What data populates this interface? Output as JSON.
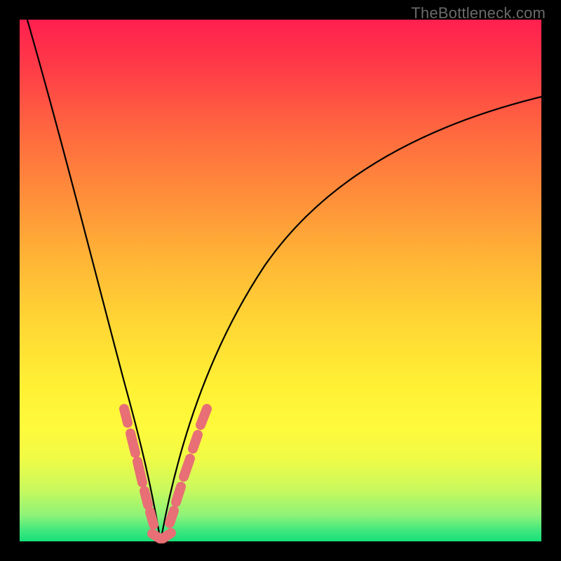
{
  "watermark": "TheBottleneck.com",
  "colors": {
    "black": "#000000",
    "segment": "#e86f75",
    "gradient_top": "#ff1f4f",
    "gradient_bottom": "#17df78"
  },
  "chart_data": {
    "type": "line",
    "title": "",
    "xlabel": "",
    "ylabel": "",
    "xlim": [
      0,
      100
    ],
    "ylim": [
      0,
      100
    ],
    "grid": false,
    "background": "red-yellow-green vertical gradient",
    "series": [
      {
        "name": "left-curve",
        "x": [
          0,
          2,
          4,
          6,
          8,
          10,
          12,
          14,
          16,
          18,
          20,
          21,
          22,
          23,
          24,
          25,
          26,
          27
        ],
        "y": [
          100,
          89,
          79,
          70,
          61,
          53,
          46,
          39,
          33,
          27,
          21,
          18,
          15,
          13,
          10,
          7,
          4,
          0
        ],
        "curve_note": "steep descent from top-left edge to around x≈27"
      },
      {
        "name": "right-curve",
        "x": [
          27,
          28,
          29,
          30,
          32,
          35,
          40,
          45,
          50,
          55,
          60,
          65,
          70,
          75,
          80,
          85,
          90,
          95,
          100
        ],
        "y": [
          0,
          4,
          8,
          12,
          19,
          27,
          38,
          47,
          54,
          60,
          65,
          69,
          73,
          76,
          79,
          81,
          83,
          84,
          85
        ],
        "curve_note": "rises from the minimum; decelerates toward the right edge, ending around y≈85"
      }
    ],
    "highlighted_segments": {
      "comment": "rounded salmon bead overlays near the minimum of the V",
      "left_dashes_x": [
        19.5,
        21.5,
        22.8,
        24.0,
        25.2,
        26.3
      ],
      "right_dashes_x": [
        28.0,
        29.0,
        30.2,
        31.5,
        33.2,
        34.8
      ],
      "bottom_x_range": [
        25.0,
        29.0
      ]
    },
    "minimum_x": 27,
    "minimum_y": 0
  }
}
